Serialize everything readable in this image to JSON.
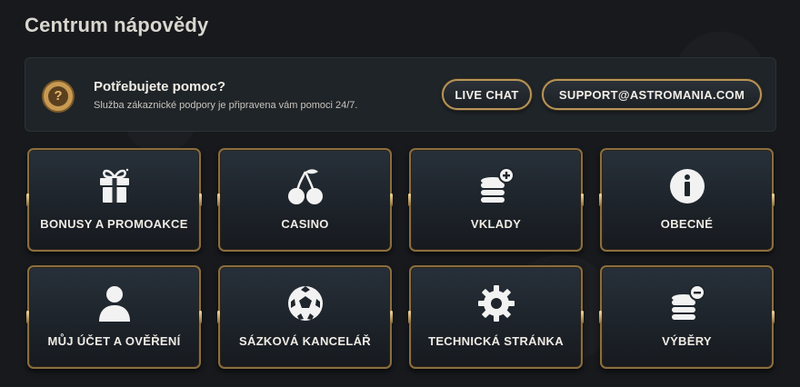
{
  "page": {
    "title": "Centrum nápovědy"
  },
  "help": {
    "title": "Potřebujete pomoc?",
    "subtitle": "Služba zákaznické podpory je připravena vám pomoci 24/7.",
    "live_chat_label": "LIVE CHAT",
    "email_label": "SUPPORT@ASTROMANIA.COM",
    "icon_glyph": "?"
  },
  "categories": [
    {
      "label": "BONUSY A PROMOAKCE",
      "icon": "gift-icon"
    },
    {
      "label": "CASINO",
      "icon": "cherries-icon"
    },
    {
      "label": "VKLADY",
      "icon": "coins-plus-icon"
    },
    {
      "label": "OBECNÉ",
      "icon": "info-icon"
    },
    {
      "label": "MŮJ ÚČET A OVĚŘENÍ",
      "icon": "user-icon"
    },
    {
      "label": "SÁZKOVÁ KANCELÁŘ",
      "icon": "soccer-ball-icon"
    },
    {
      "label": "TECHNICKÁ STRÁNKA",
      "icon": "gear-icon"
    },
    {
      "label": "VÝBĚRY",
      "icon": "coins-minus-icon"
    }
  ],
  "colors": {
    "accent_gold": "#b89558",
    "card_border": "#8a6e3e",
    "background": "#17191d"
  }
}
